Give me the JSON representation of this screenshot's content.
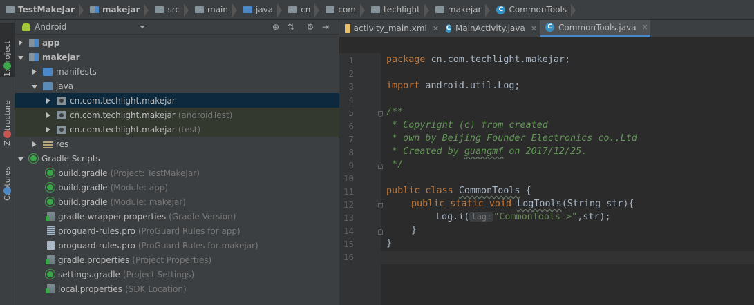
{
  "breadcrumb": [
    "TestMakeJar",
    "makejar",
    "src",
    "main",
    "java",
    "cn",
    "com",
    "techlight",
    "makejar",
    "CommonTools"
  ],
  "left_strip": {
    "project": "1: Project",
    "structure": "Z: Structure",
    "captures": "Captures"
  },
  "project_panel": {
    "view_selector": "Android",
    "tree": [
      {
        "label": "app",
        "sub": ""
      },
      {
        "label": "makejar",
        "sub": ""
      },
      {
        "label": "manifests",
        "sub": ""
      },
      {
        "label": "java",
        "sub": ""
      },
      {
        "label": "cn.com.techlight.makejar",
        "sub": ""
      },
      {
        "label": "cn.com.techlight.makejar",
        "sub": "(androidTest)"
      },
      {
        "label": "cn.com.techlight.makejar",
        "sub": "(test)"
      },
      {
        "label": "res",
        "sub": ""
      },
      {
        "label": "Gradle Scripts",
        "sub": ""
      },
      {
        "label": "build.gradle",
        "sub": "(Project: TestMakeJar)"
      },
      {
        "label": "build.gradle",
        "sub": "(Module: app)"
      },
      {
        "label": "build.gradle",
        "sub": "(Module: makejar)"
      },
      {
        "label": "gradle-wrapper.properties",
        "sub": "(Gradle Version)"
      },
      {
        "label": "proguard-rules.pro",
        "sub": "(ProGuard Rules for app)"
      },
      {
        "label": "proguard-rules.pro",
        "sub": "(ProGuard Rules for makejar)"
      },
      {
        "label": "gradle.properties",
        "sub": "(Project Properties)"
      },
      {
        "label": "settings.gradle",
        "sub": "(Project Settings)"
      },
      {
        "label": "local.properties",
        "sub": "(SDK Location)"
      }
    ]
  },
  "editor": {
    "tabs": [
      "activity_main.xml",
      "MainActivity.java",
      "CommonTools.java"
    ],
    "line_numbers": [
      "1",
      "2",
      "3",
      "4",
      "5",
      "6",
      "7",
      "8",
      "9",
      "10",
      "11",
      "12",
      "13",
      "14",
      "15",
      "16"
    ],
    "code": {
      "package_kw": "package",
      "package_name": " cn.com.techlight.makejar;",
      "import_kw": "import",
      "import_name": " android.util.Log;",
      "c5": "/**",
      "c6": " * Copyright (c) from created",
      "c7": " * own by Beijing Founder Electronics co.,Ltd",
      "c8a": " * Created by ",
      "c8b": "guangmf",
      "c8c": " on 2017/12/25.",
      "c9": " */",
      "l11_kw": "public class",
      "l11_name": "CommonTools",
      "l11_end": " {",
      "l12_kw": "public static void",
      "l12_name": "LogTools",
      "l12_end": "(String str){",
      "l13_a": "Log.i(",
      "l13_hint": "tag:",
      "l13_str": "\"CommonTools->\"",
      "l13_end": ",str);",
      "l14": "}",
      "l15": "}"
    }
  }
}
